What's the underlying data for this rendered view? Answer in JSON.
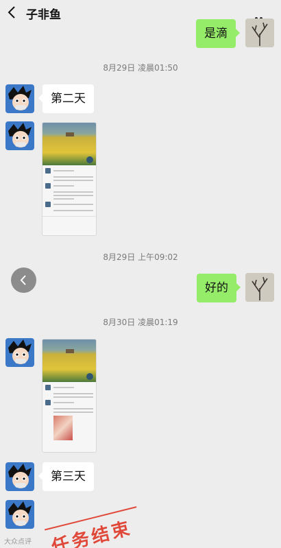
{
  "header": {
    "title": "子非鱼"
  },
  "messages": {
    "m1": "是滴",
    "m2": "第二天",
    "m3": "好的",
    "m4": "第三天"
  },
  "timestamps": {
    "t1": "8月29日 凌晨01:50",
    "t2": "8月29日 上午09:02",
    "t3": "8月30日 凌晨01:19"
  },
  "stamp": {
    "text": "任务结束"
  },
  "watermark": {
    "text": "大众点评"
  },
  "colors": {
    "background": "#ededed",
    "outgoing_bubble": "#95ec69",
    "incoming_bubble": "#ffffff",
    "stamp": "#e0493a"
  }
}
